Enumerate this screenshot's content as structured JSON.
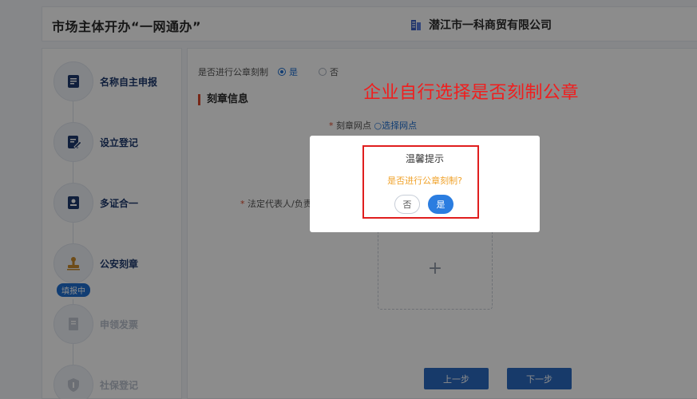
{
  "header": {
    "title": "市场主体开办“一网通办”",
    "company": "潜江市一科商贸有限公司"
  },
  "sidebar": {
    "steps": [
      {
        "label": "名称自主申报"
      },
      {
        "label": "设立登记"
      },
      {
        "label": "多证合一"
      },
      {
        "label": "公安刻章"
      },
      {
        "label": "申领发票"
      },
      {
        "label": "社保登记"
      }
    ],
    "current_badge": "填报中"
  },
  "form": {
    "question": "是否进行公章刻制",
    "option_yes": "是",
    "option_no": "否",
    "section_title": "刻章信息",
    "shop_label": "刻章网点",
    "shop_link": "选择网点",
    "legal_label": "法定代表人/负责",
    "upload_plus": "+",
    "prev_button": "上一步",
    "next_button": "下一步"
  },
  "annotation": "企业自行选择是否刻制公章",
  "modal": {
    "title": "温馨提示",
    "message": "是否进行公章刻制?",
    "no_label": "否",
    "yes_label": "是"
  },
  "colors": {
    "primary": "#1f6fd1",
    "button": "#2b6bc2",
    "annotation": "#f01e1e",
    "warning_text": "#f0a22a"
  }
}
